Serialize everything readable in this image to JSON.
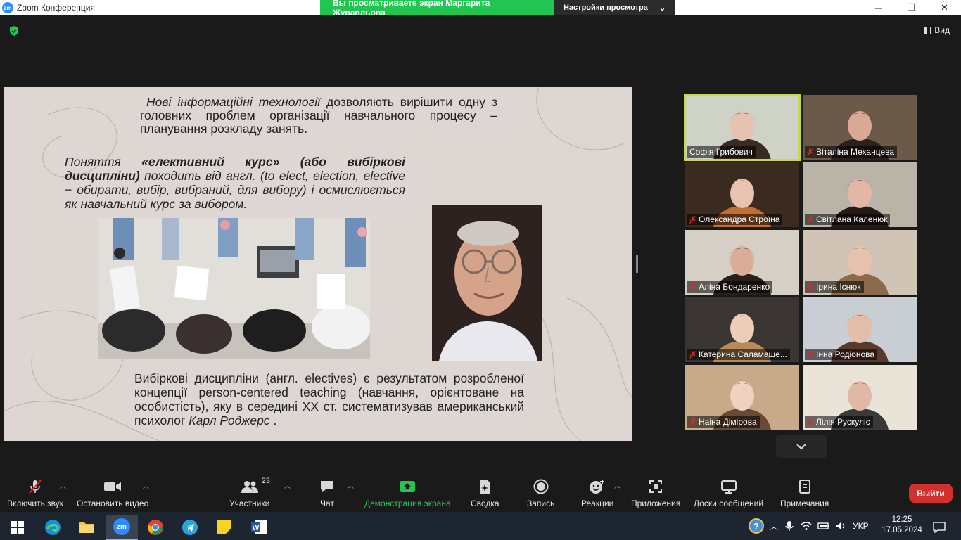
{
  "window": {
    "title": "Zoom Конференция",
    "logo_text": "zm"
  },
  "share_banner": {
    "viewing_text": "Вы просматриваете экран Маргарита Журавльова",
    "view_settings_label": "Настройки просмотра"
  },
  "header": {
    "view_label": "Вид"
  },
  "slide": {
    "para1_italic": "Нові інформаційні технології",
    "para1_rest": " дозволяють вирішити одну з головних проблем організації навчального процесу – планування розкладу занять.",
    "para2_lead": "Поняття ",
    "para2_bold": "«елективний курс» (або вибіркові дисципліни)",
    "para2_rest": " походить від англ. (to elect, election, elective − обирати, вибір, вибраний, для вибору) і осмислюється як навчальний курс за вибором.",
    "para3_main": "Вибіркові дисципліни (англ. electives) є результатом розробленої концепції person-centered teaching (навчання, орієнтоване на особистість), яку в середині XX ст. систематизував американський психолог ",
    "para3_italic": "Карл Роджерс",
    "para3_end": " ."
  },
  "participants": [
    {
      "name": "Софія Грибович",
      "muted": false,
      "active": true
    },
    {
      "name": "Віталіна Механцева",
      "muted": true
    },
    {
      "name": "Олександра Строїна",
      "muted": true
    },
    {
      "name": "Світлана Каленюк",
      "muted": true
    },
    {
      "name": "Аліна Бондаренко",
      "muted": true
    },
    {
      "name": "Ірина Існюк",
      "muted": true
    },
    {
      "name": "Катерина Саламаше...",
      "muted": true
    },
    {
      "name": "Інна Родіонова",
      "muted": true
    },
    {
      "name": "Наіна Дімірова",
      "muted": true
    },
    {
      "name": "Лілія Рускуліс",
      "muted": true
    }
  ],
  "toolbar": {
    "unmute_label": "Включить звук",
    "stop_video_label": "Остановить видео",
    "participants_label": "Участники",
    "participants_count": "23",
    "chat_label": "Чат",
    "share_screen_label": "Демонстрация экрана",
    "summary_label": "Сводка",
    "record_label": "Запись",
    "reactions_label": "Реакции",
    "apps_label": "Приложения",
    "whiteboards_label": "Доски сообщений",
    "notes_label": "Примечания",
    "leave_label": "Выйти"
  },
  "taskbar": {
    "language": "УКР",
    "time": "12:25",
    "date": "17.05.2024"
  },
  "colors": {
    "share_green": "#23c552",
    "active_speaker": "#c7d94a",
    "leave_red": "#d0312d",
    "slide_bg": "#ddd6d2"
  }
}
